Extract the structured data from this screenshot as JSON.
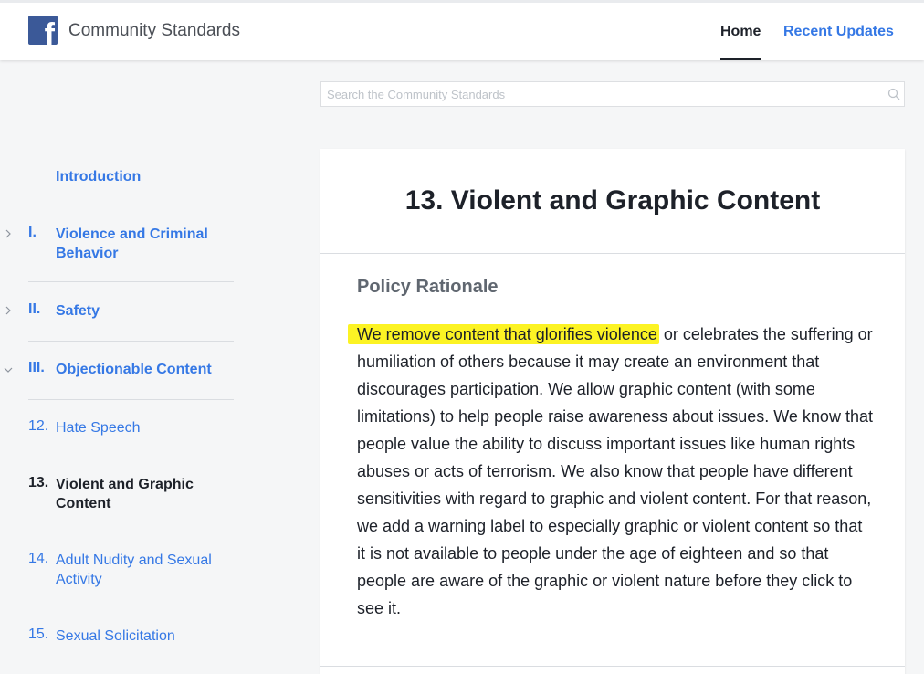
{
  "header": {
    "site_title": "Community Standards",
    "logo_icon": "facebook-logo-icon",
    "nav": [
      {
        "label": "Home",
        "active": true
      },
      {
        "label": "Recent Updates",
        "active": false
      }
    ]
  },
  "search": {
    "placeholder": "Search the Community Standards",
    "value": ""
  },
  "sidebar": {
    "intro": "Introduction",
    "items": [
      {
        "num": "I.",
        "label": "Violence and Criminal Behavior",
        "expanded": false
      },
      {
        "num": "II.",
        "label": "Safety",
        "expanded": false
      },
      {
        "num": "III.",
        "label": "Objectionable Content",
        "expanded": true
      }
    ],
    "subitems": [
      {
        "num": "12.",
        "label": "Hate Speech"
      },
      {
        "num": "13.",
        "label": "Violent and Graphic Content"
      },
      {
        "num": "14.",
        "label": "Adult Nudity and Sexual Activity"
      },
      {
        "num": "15.",
        "label": "Sexual Solicitation"
      }
    ]
  },
  "main": {
    "title": "13. Violent and Graphic Content",
    "section_heading": "Policy Rationale",
    "highlighted_text": "We remove content that glorifies violence",
    "body_text": " or celebrates the suffering or humiliation of others because it may create an environment that discourages participation. We allow graphic content (with some limitations) to help people raise awareness about issues. We know that people value the ability to discuss important issues like human rights abuses or acts of terrorism. We also know that people have different sensitivities with regard to graphic and violent content. For that reason, we add a warning label to especially graphic or violent content so that it is not available to people under the age of eighteen and so that people are aware of the graphic or violent nature before they click to see it.",
    "highlight_color": "#fcf324"
  },
  "colors": {
    "link": "#3578e5",
    "brand": "#3b5998"
  }
}
